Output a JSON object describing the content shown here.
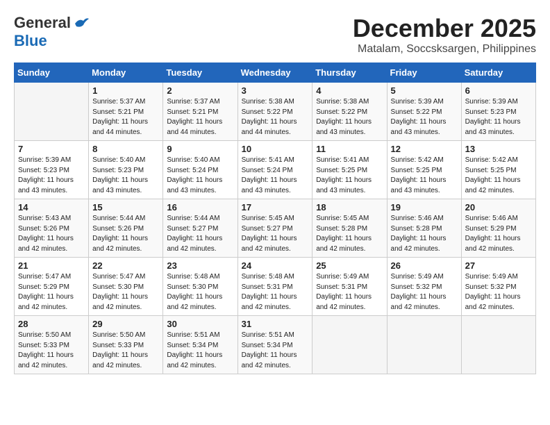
{
  "header": {
    "logo_line1": "General",
    "logo_line2": "Blue",
    "title": "December 2025",
    "subtitle": "Matalam, Soccsksargen, Philippines"
  },
  "weekdays": [
    "Sunday",
    "Monday",
    "Tuesday",
    "Wednesday",
    "Thursday",
    "Friday",
    "Saturday"
  ],
  "weeks": [
    [
      {
        "day": "",
        "info": ""
      },
      {
        "day": "1",
        "info": "Sunrise: 5:37 AM\nSunset: 5:21 PM\nDaylight: 11 hours\nand 44 minutes."
      },
      {
        "day": "2",
        "info": "Sunrise: 5:37 AM\nSunset: 5:21 PM\nDaylight: 11 hours\nand 44 minutes."
      },
      {
        "day": "3",
        "info": "Sunrise: 5:38 AM\nSunset: 5:22 PM\nDaylight: 11 hours\nand 44 minutes."
      },
      {
        "day": "4",
        "info": "Sunrise: 5:38 AM\nSunset: 5:22 PM\nDaylight: 11 hours\nand 43 minutes."
      },
      {
        "day": "5",
        "info": "Sunrise: 5:39 AM\nSunset: 5:22 PM\nDaylight: 11 hours\nand 43 minutes."
      },
      {
        "day": "6",
        "info": "Sunrise: 5:39 AM\nSunset: 5:23 PM\nDaylight: 11 hours\nand 43 minutes."
      }
    ],
    [
      {
        "day": "7",
        "info": "Sunrise: 5:39 AM\nSunset: 5:23 PM\nDaylight: 11 hours\nand 43 minutes."
      },
      {
        "day": "8",
        "info": "Sunrise: 5:40 AM\nSunset: 5:23 PM\nDaylight: 11 hours\nand 43 minutes."
      },
      {
        "day": "9",
        "info": "Sunrise: 5:40 AM\nSunset: 5:24 PM\nDaylight: 11 hours\nand 43 minutes."
      },
      {
        "day": "10",
        "info": "Sunrise: 5:41 AM\nSunset: 5:24 PM\nDaylight: 11 hours\nand 43 minutes."
      },
      {
        "day": "11",
        "info": "Sunrise: 5:41 AM\nSunset: 5:25 PM\nDaylight: 11 hours\nand 43 minutes."
      },
      {
        "day": "12",
        "info": "Sunrise: 5:42 AM\nSunset: 5:25 PM\nDaylight: 11 hours\nand 43 minutes."
      },
      {
        "day": "13",
        "info": "Sunrise: 5:42 AM\nSunset: 5:25 PM\nDaylight: 11 hours\nand 42 minutes."
      }
    ],
    [
      {
        "day": "14",
        "info": "Sunrise: 5:43 AM\nSunset: 5:26 PM\nDaylight: 11 hours\nand 42 minutes."
      },
      {
        "day": "15",
        "info": "Sunrise: 5:44 AM\nSunset: 5:26 PM\nDaylight: 11 hours\nand 42 minutes."
      },
      {
        "day": "16",
        "info": "Sunrise: 5:44 AM\nSunset: 5:27 PM\nDaylight: 11 hours\nand 42 minutes."
      },
      {
        "day": "17",
        "info": "Sunrise: 5:45 AM\nSunset: 5:27 PM\nDaylight: 11 hours\nand 42 minutes."
      },
      {
        "day": "18",
        "info": "Sunrise: 5:45 AM\nSunset: 5:28 PM\nDaylight: 11 hours\nand 42 minutes."
      },
      {
        "day": "19",
        "info": "Sunrise: 5:46 AM\nSunset: 5:28 PM\nDaylight: 11 hours\nand 42 minutes."
      },
      {
        "day": "20",
        "info": "Sunrise: 5:46 AM\nSunset: 5:29 PM\nDaylight: 11 hours\nand 42 minutes."
      }
    ],
    [
      {
        "day": "21",
        "info": "Sunrise: 5:47 AM\nSunset: 5:29 PM\nDaylight: 11 hours\nand 42 minutes."
      },
      {
        "day": "22",
        "info": "Sunrise: 5:47 AM\nSunset: 5:30 PM\nDaylight: 11 hours\nand 42 minutes."
      },
      {
        "day": "23",
        "info": "Sunrise: 5:48 AM\nSunset: 5:30 PM\nDaylight: 11 hours\nand 42 minutes."
      },
      {
        "day": "24",
        "info": "Sunrise: 5:48 AM\nSunset: 5:31 PM\nDaylight: 11 hours\nand 42 minutes."
      },
      {
        "day": "25",
        "info": "Sunrise: 5:49 AM\nSunset: 5:31 PM\nDaylight: 11 hours\nand 42 minutes."
      },
      {
        "day": "26",
        "info": "Sunrise: 5:49 AM\nSunset: 5:32 PM\nDaylight: 11 hours\nand 42 minutes."
      },
      {
        "day": "27",
        "info": "Sunrise: 5:49 AM\nSunset: 5:32 PM\nDaylight: 11 hours\nand 42 minutes."
      }
    ],
    [
      {
        "day": "28",
        "info": "Sunrise: 5:50 AM\nSunset: 5:33 PM\nDaylight: 11 hours\nand 42 minutes."
      },
      {
        "day": "29",
        "info": "Sunrise: 5:50 AM\nSunset: 5:33 PM\nDaylight: 11 hours\nand 42 minutes."
      },
      {
        "day": "30",
        "info": "Sunrise: 5:51 AM\nSunset: 5:34 PM\nDaylight: 11 hours\nand 42 minutes."
      },
      {
        "day": "31",
        "info": "Sunrise: 5:51 AM\nSunset: 5:34 PM\nDaylight: 11 hours\nand 42 minutes."
      },
      {
        "day": "",
        "info": ""
      },
      {
        "day": "",
        "info": ""
      },
      {
        "day": "",
        "info": ""
      }
    ]
  ]
}
